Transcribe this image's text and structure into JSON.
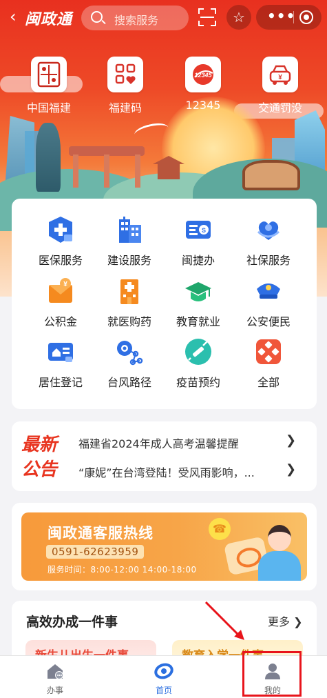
{
  "header": {
    "back_icon": "chevron-left-icon",
    "app_title": "闽政通",
    "search_placeholder": "搜索服务",
    "scan_icon": "scan-icon",
    "star_icon": "star-icon",
    "more_icon": "more-dots-icon",
    "close_icon": "target-circle-icon"
  },
  "quick_entries": [
    {
      "label": "中国福建",
      "icon": "fujian-seal-icon"
    },
    {
      "label": "福建码",
      "icon": "qr-heart-icon"
    },
    {
      "label": "12345",
      "icon": "hotline-12345-icon"
    },
    {
      "label": "交通罚没",
      "icon": "car-fine-icon"
    }
  ],
  "services": [
    {
      "label": "医保服务",
      "icon": "medical-insurance-icon",
      "color": "#2f6fe4"
    },
    {
      "label": "建设服务",
      "icon": "building-icon",
      "color": "#2f6fe4"
    },
    {
      "label": "闽捷办",
      "icon": "id-card-icon",
      "color": "#2f6fe4"
    },
    {
      "label": "社保服务",
      "icon": "social-security-icon",
      "color": "#2f6fe4"
    },
    {
      "label": "公积金",
      "icon": "housing-fund-icon",
      "color": "#f58a1f"
    },
    {
      "label": "就医购药",
      "icon": "hospital-icon",
      "color": "#f58a1f"
    },
    {
      "label": "教育就业",
      "icon": "graduation-cap-icon",
      "color": "#1fa66b"
    },
    {
      "label": "公安便民",
      "icon": "police-cap-icon",
      "color": "#2f6fe4"
    },
    {
      "label": "居住登记",
      "icon": "residence-icon",
      "color": "#2f6fe4"
    },
    {
      "label": "台风路径",
      "icon": "typhoon-icon",
      "color": "#2f6fe4"
    },
    {
      "label": "疫苗预约",
      "icon": "vaccine-icon",
      "color": "#2bbfae"
    },
    {
      "label": "全部",
      "icon": "all-grid-icon",
      "color": "#f0563a"
    }
  ],
  "notice": {
    "tag": "最新公告",
    "items": [
      "福建省2024年成人高考温馨提醒",
      "“康妮”在台湾登陆！受风雨影响，..."
    ]
  },
  "hotline": {
    "title": "闽政通客服热线",
    "phone": "0591-62623959",
    "hours": "服务时间：8:00-12:00 14:00-18:00"
  },
  "efficiency": {
    "title": "高效办成一件事",
    "more": "更多",
    "tiles": [
      "新生儿出生一件事",
      "教育入学一件事"
    ]
  },
  "tabbar": {
    "tabs": [
      {
        "label": "办事",
        "icon": "affairs-icon",
        "active": false
      },
      {
        "label": "首页",
        "icon": "home-logo-icon",
        "active": true
      },
      {
        "label": "我的",
        "icon": "user-icon",
        "active": false
      }
    ]
  },
  "colors": {
    "brand_red": "#e8301f",
    "accent_blue": "#2b6fe0",
    "highlight_red": "#e8141b"
  }
}
